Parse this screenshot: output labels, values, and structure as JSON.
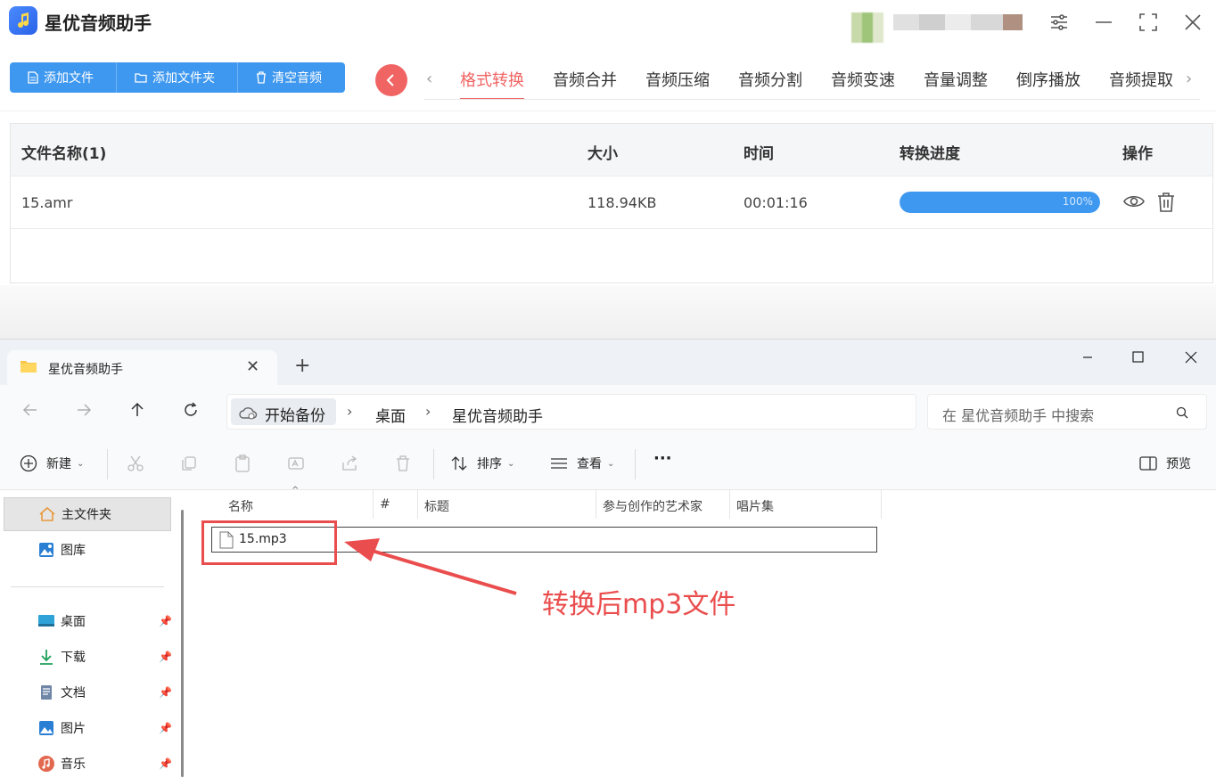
{
  "app": {
    "name": "星优音频助手",
    "toolbar": {
      "add_file": "添加文件",
      "add_folder": "添加文件夹",
      "clear_audio": "清空音频"
    },
    "tabs": [
      {
        "label": "格式转换",
        "active": true
      },
      {
        "label": "音频合并",
        "active": false
      },
      {
        "label": "音频压缩",
        "active": false
      },
      {
        "label": "音频分割",
        "active": false
      },
      {
        "label": "音频变速",
        "active": false
      },
      {
        "label": "音量调整",
        "active": false
      },
      {
        "label": "倒序播放",
        "active": false
      },
      {
        "label": "音频提取",
        "active": false
      }
    ],
    "table": {
      "headers": {
        "name": "文件名称(1)",
        "size": "大小",
        "time": "时间",
        "progress": "转换进度",
        "action": "操作"
      },
      "rows": [
        {
          "name": "15.amr",
          "size": "118.94KB",
          "time": "00:01:16",
          "progress_text": "100%",
          "progress": 1.0
        }
      ]
    },
    "colors": {
      "primary": "#3f98ef",
      "accent": "#f16464"
    }
  },
  "explorer": {
    "tab_title": "星优音频助手",
    "new_tab": "+",
    "address": {
      "home": "开始备份",
      "crumbs": [
        "桌面",
        "星优音频助手"
      ]
    },
    "search_placeholder": "在 星优音频助手 中搜索",
    "commands": {
      "new": "新建",
      "sort": "排序",
      "view": "查看",
      "more": "···",
      "preview": "预览"
    },
    "sidebar": {
      "items": [
        {
          "label": "主文件夹",
          "icon": "home-icon"
        },
        {
          "label": "图库",
          "icon": "gallery-icon"
        },
        {
          "label": "桌面",
          "icon": "desktop-icon"
        },
        {
          "label": "下载",
          "icon": "download-icon"
        },
        {
          "label": "文档",
          "icon": "document-icon"
        },
        {
          "label": "图片",
          "icon": "pictures-icon"
        },
        {
          "label": "音乐",
          "icon": "music-icon"
        }
      ]
    },
    "columns": {
      "name": "名称",
      "number": "#",
      "title": "标题",
      "artist": "参与创作的艺术家",
      "album": "唱片集"
    },
    "files": [
      {
        "name": "15.mp3"
      }
    ]
  },
  "annotation": {
    "text": "转换后mp3文件",
    "color": "#ea4d4d"
  }
}
